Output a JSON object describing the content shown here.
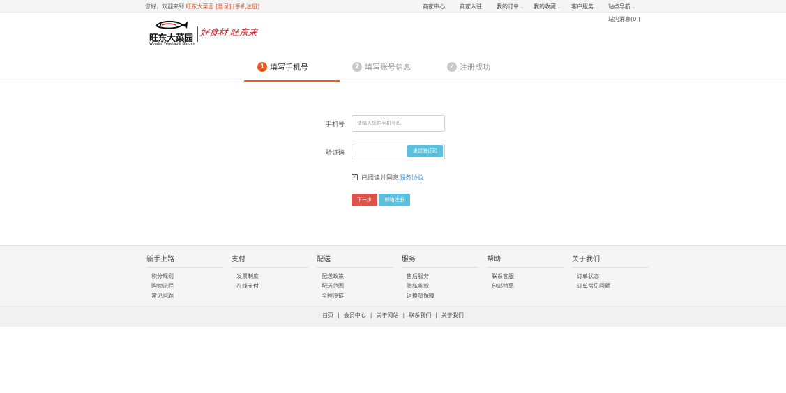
{
  "topbar": {
    "welcome": "您好，欢迎来到",
    "site_name": "旺东大菜园",
    "login": "[登录]",
    "register": "[手机注册]",
    "nav": [
      {
        "label": "商家中心",
        "dropdown": false
      },
      {
        "label": "商家入驻",
        "dropdown": false
      },
      {
        "label": "我的订单",
        "dropdown": true
      },
      {
        "label": "我的收藏",
        "dropdown": true
      },
      {
        "label": "客户服务",
        "dropdown": true
      },
      {
        "label": "站点导航",
        "dropdown": true
      }
    ],
    "messages": "站内消息(0 )",
    "caret": "⌄"
  },
  "logo": {
    "cn": "旺东大菜园",
    "en": "Wonder Vegetable Garden",
    "slogan": "好食材 旺东来"
  },
  "steps": [
    {
      "num": "1",
      "label": "填写手机号",
      "active": true
    },
    {
      "num": "2",
      "label": "填写账号信息",
      "active": false
    },
    {
      "num": "✓",
      "label": "注册成功",
      "active": false
    }
  ],
  "form": {
    "phone_label": "手机号",
    "phone_placeholder": "请输入您的手机号码",
    "code_label": "验证码",
    "code_value": "",
    "send_code": "发送验证码",
    "agree_text": "已阅读并同意",
    "agree_link": "服务协议",
    "checkbox_mark": "✓",
    "next": "下一步",
    "email_register": "邮箱注册"
  },
  "footer": {
    "columns": [
      {
        "title": "新手上路",
        "items": [
          "积分规则",
          "购物流程",
          "常见问题"
        ]
      },
      {
        "title": "支付",
        "items": [
          "发票制度",
          "在线支付"
        ]
      },
      {
        "title": "配送",
        "items": [
          "配送政策",
          "配送范围",
          "全程冷链"
        ]
      },
      {
        "title": "服务",
        "items": [
          "售后服务",
          "隐私条款",
          "退换货保障"
        ]
      },
      {
        "title": "帮助",
        "items": [
          "联系客服",
          "包邮特惠"
        ]
      },
      {
        "title": "关于我们",
        "items": [
          "订单状态",
          "订单常见问题"
        ]
      }
    ],
    "links": [
      "首页",
      "会员中心",
      "关于网站",
      "联系我们",
      "关于我们"
    ],
    "separator": "|"
  },
  "colors": {
    "accent": "#ef5a1e",
    "next_button": "#d9534f",
    "info_button": "#5bc0de",
    "link": "#3b8fd6",
    "brand_red": "#c8232b"
  }
}
